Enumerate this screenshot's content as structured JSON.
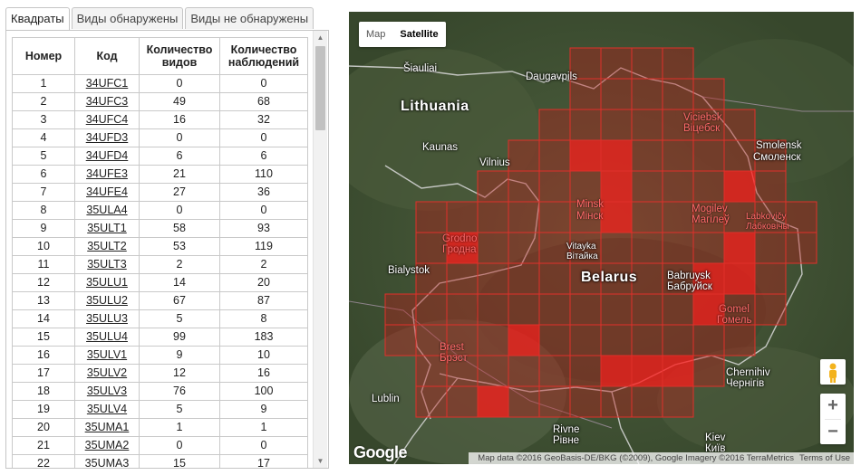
{
  "tabs": [
    "Квадраты",
    "Виды обнаружены",
    "Виды не обнаружены"
  ],
  "table": {
    "headers": [
      "Номер",
      "Код",
      "Количество видов",
      "Количество наблюдений"
    ],
    "rows": [
      [
        "1",
        "34UFC1",
        "0",
        "0"
      ],
      [
        "2",
        "34UFC3",
        "49",
        "68"
      ],
      [
        "3",
        "34UFC4",
        "16",
        "32"
      ],
      [
        "4",
        "34UFD3",
        "0",
        "0"
      ],
      [
        "5",
        "34UFD4",
        "6",
        "6"
      ],
      [
        "6",
        "34UFE3",
        "21",
        "110"
      ],
      [
        "7",
        "34UFE4",
        "27",
        "36"
      ],
      [
        "8",
        "35ULA4",
        "0",
        "0"
      ],
      [
        "9",
        "35ULT1",
        "58",
        "93"
      ],
      [
        "10",
        "35ULT2",
        "53",
        "119"
      ],
      [
        "11",
        "35ULT3",
        "2",
        "2"
      ],
      [
        "12",
        "35ULU1",
        "14",
        "20"
      ],
      [
        "13",
        "35ULU2",
        "67",
        "87"
      ],
      [
        "14",
        "35ULU3",
        "5",
        "8"
      ],
      [
        "15",
        "35ULU4",
        "99",
        "183"
      ],
      [
        "16",
        "35ULV1",
        "9",
        "10"
      ],
      [
        "17",
        "35ULV2",
        "12",
        "16"
      ],
      [
        "18",
        "35ULV3",
        "76",
        "100"
      ],
      [
        "19",
        "35ULV4",
        "5",
        "9"
      ],
      [
        "20",
        "35UMA1",
        "1",
        "1"
      ],
      [
        "21",
        "35UMA2",
        "0",
        "0"
      ],
      [
        "22",
        "35UMA3",
        "15",
        "17"
      ]
    ]
  },
  "map": {
    "types": [
      "Map",
      "Satellite"
    ],
    "selected_type": "Satellite",
    "labels": {
      "lithuania": "Lithuania",
      "belarus": "Belarus",
      "siauliai": "Šiauliai",
      "daugavpils": "Daugavpils",
      "kaunas": "Kaunas",
      "vilnius": "Vilnius",
      "minsk": "Minsk",
      "minsk_ru": "Мінск",
      "vitebsk": "Viciebsk",
      "vitebsk_ru": "Віцебск",
      "smolensk": "Smolensk",
      "smolensk_ru": "Смоленск",
      "grodno": "Grodno",
      "grodno_ru": "Гродна",
      "mogilev": "Mogilev",
      "mogilev_ru": "Магілеў",
      "lobkovichi": "Labkovičy",
      "lobkovichi_ru": "Лабковічы",
      "bialystok": "Bialystok",
      "vitayka": "Vitayka",
      "vitayka_ru": "Вітайка",
      "babruysk": "Babruysk",
      "babruysk_ru": "Бабруйск",
      "gomel": "Gomel",
      "gomel_ru": "Гомель",
      "brest": "Brest",
      "brest_ru": "Брэст",
      "chernihiv": "Chernihiv",
      "chernihiv_ru": "Чернігів",
      "lublin": "Lublin",
      "rivne": "Rivne",
      "rivne_ru": "Рівне",
      "kiev": "Kiev",
      "kiev_ru": "Київ"
    },
    "logo": "Google",
    "attribution": "Map data ©2016 GeoBasis-DE/BKG (©2009), Google Imagery ©2016 TerraMetrics",
    "terms": "Terms of Use",
    "zoom_in": "+",
    "zoom_out": "−",
    "colors": {
      "grid": "#e0302a",
      "fill": "#c01818",
      "hot": "#ff1a1a"
    }
  }
}
